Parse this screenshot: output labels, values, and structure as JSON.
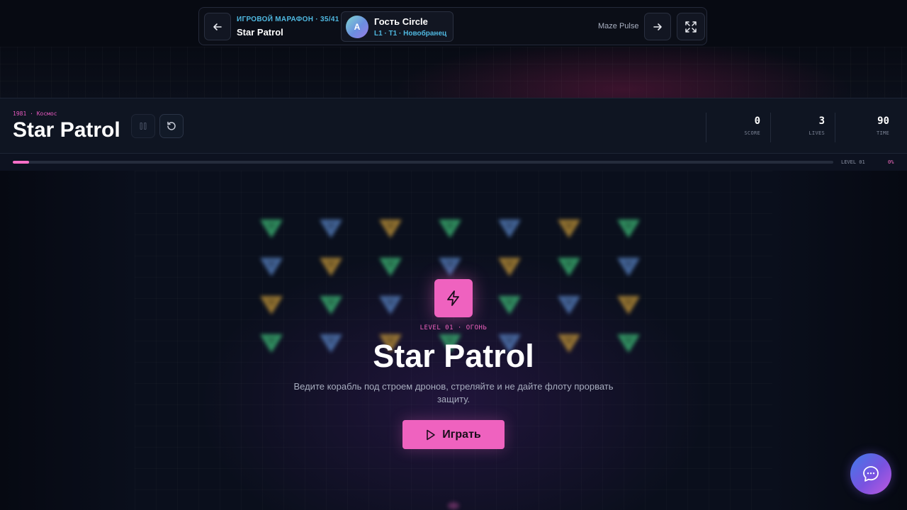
{
  "navbar": {
    "marathon_label": "ИГРОВОЙ МАРАФОН · 35/41",
    "current_game": "Star Patrol",
    "player": {
      "avatar_letter": "A",
      "name": "Гость Circle",
      "rank": "L1 · T1 · Новобранец"
    },
    "next_game": "Maze Pulse",
    "icons": {
      "back": "arrow-left-icon",
      "next": "arrow-right-icon",
      "fullscreen": "expand-icon"
    }
  },
  "game_header": {
    "meta": "1981 · Космос",
    "title": "Star Patrol",
    "stats": [
      {
        "value": "0",
        "label": "SCORE"
      },
      {
        "value": "3",
        "label": "LIVES"
      },
      {
        "value": "90",
        "label": "TIME"
      }
    ],
    "icons": {
      "pause": "pause-icon",
      "restart": "restart-icon"
    }
  },
  "progress": {
    "level_label": "LEVEL 01",
    "percent_label": "0%",
    "fill_fraction": 0.02
  },
  "overlay": {
    "level_tag": "LEVEL 01 · ОГОНЬ",
    "title": "Star Patrol",
    "description": "Ведите корабль под строем дронов, стреляйте и не дайте флоту прорвать защиту.",
    "play_label": "Играть",
    "icons": {
      "badge": "lightning-icon",
      "play": "play-icon"
    }
  },
  "drone_colors": {
    "green": "#3fbf7a",
    "blue": "#5a86c8",
    "gold": "#c89a3a"
  },
  "drone_rows": [
    [
      "green",
      "blue",
      "gold",
      "green",
      "blue",
      "gold",
      "green"
    ],
    [
      "blue",
      "gold",
      "green",
      "blue",
      "gold",
      "green",
      "blue"
    ],
    [
      "gold",
      "green",
      "blue",
      "gold",
      "green",
      "blue",
      "gold"
    ],
    [
      "green",
      "blue",
      "gold",
      "green",
      "blue",
      "gold",
      "green"
    ]
  ],
  "accent_color": "#ef62bf",
  "chat": {
    "icon": "chat-bubble-icon"
  }
}
